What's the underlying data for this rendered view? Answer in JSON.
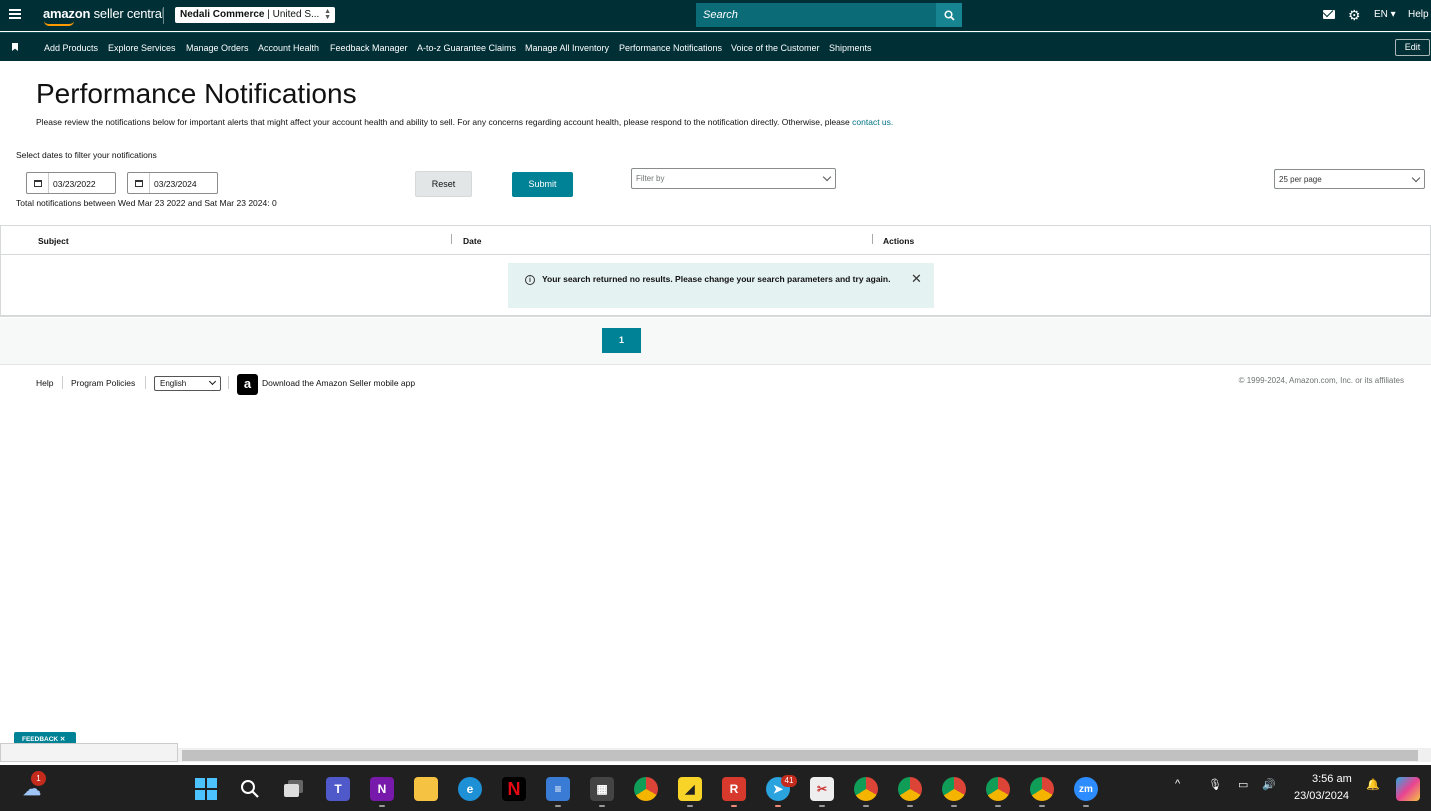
{
  "topbar": {
    "logo_main": "amazon",
    "logo_sub": "seller central",
    "account": "Nedali Commerce",
    "account_region": "United S...",
    "search_placeholder": "Search",
    "language": "EN",
    "help": "Help"
  },
  "nav": {
    "items": [
      "Add Products",
      "Explore Services",
      "Manage Orders",
      "Account Health",
      "Feedback Manager",
      "A-to-z Guarantee Claims",
      "Manage All Inventory",
      "Performance Notifications",
      "Voice of the Customer",
      "Shipments"
    ],
    "edit": "Edit"
  },
  "page": {
    "title": "Performance Notifications",
    "description": "Please review the notifications below for important alerts that might affect your account health and ability to sell. For any concerns regarding account health, please respond to the notification directly. Otherwise, please",
    "contact_link": "contact us.",
    "filter_label": "Select dates to filter your notifications",
    "date_from": "03/23/2022",
    "date_to": "03/23/2024",
    "total_label": "Total notifications between Wed Mar 23 2022 and Sat Mar 23 2024: 0",
    "reset": "Reset",
    "submit": "Submit",
    "filter_placeholder": "Filter by",
    "per_page": "25 per page"
  },
  "table": {
    "columns": [
      "Subject",
      "Date",
      "Actions"
    ],
    "empty_message": "Your search returned no results. Please change your search parameters and try again."
  },
  "pagination": {
    "current_page": "1"
  },
  "footer": {
    "help": "Help",
    "program_policies": "Program Policies",
    "language": "English",
    "app_link": "Download the Amazon Seller mobile app",
    "copyright": "© 1999-2024, Amazon.com, Inc. or its affiliates"
  },
  "feedback": "FEEDBACK",
  "taskbar": {
    "weather_badge": "1",
    "telegram_badge": "41",
    "time": "3:56 am",
    "date": "23/03/2024"
  },
  "colors": {
    "header_bg": "#002f36",
    "accent_teal": "#008296",
    "alert_bg": "#e4f2f1"
  }
}
